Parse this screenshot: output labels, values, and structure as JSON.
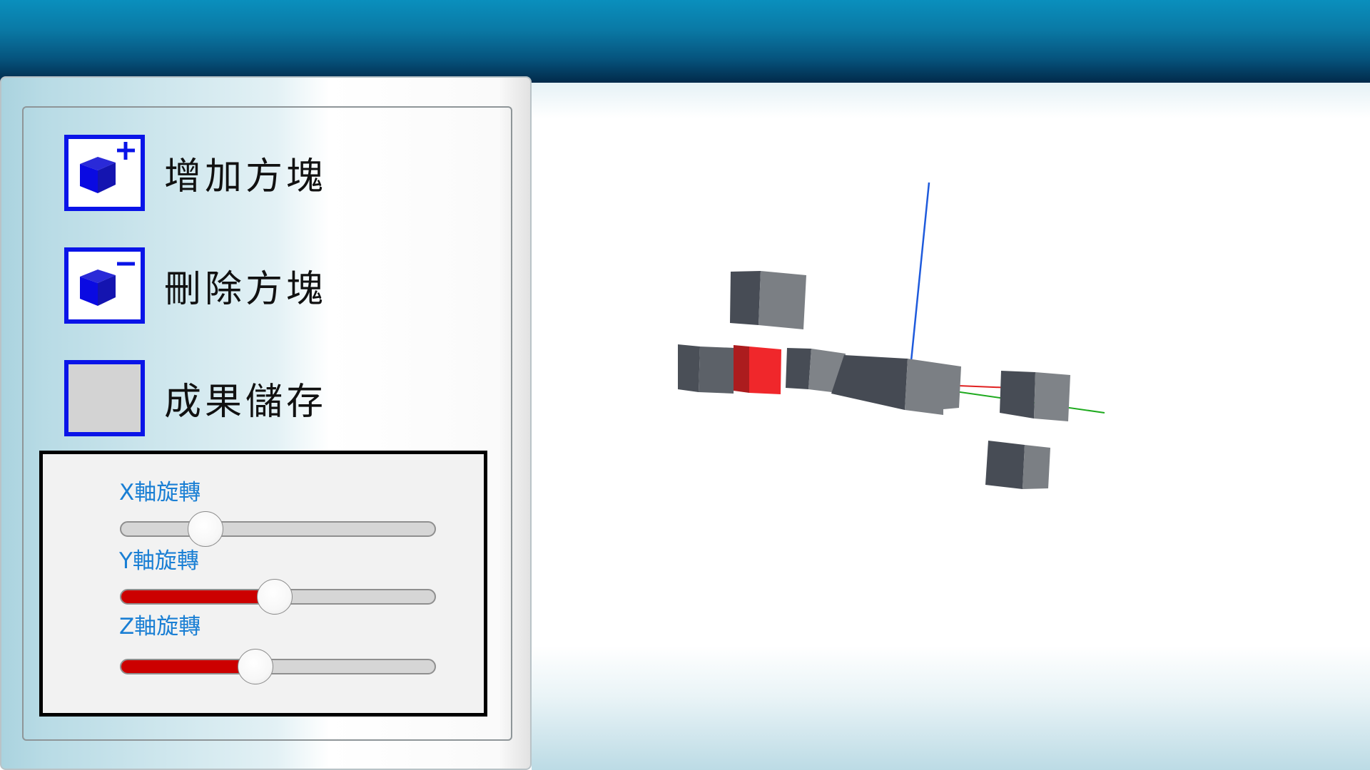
{
  "toolbar": {
    "add_block_label": "增加方塊",
    "add_block_icon": "cube-plus-icon",
    "delete_block_label": "刪除方塊",
    "delete_block_icon": "cube-minus-icon",
    "save_result_label": "成果儲存"
  },
  "rotation": {
    "x": {
      "label": "X軸旋轉",
      "value": 0.27
    },
    "y": {
      "label": "Y軸旋轉",
      "value": 0.49
    },
    "z": {
      "label": "Z軸旋轉",
      "value": 0.43
    }
  },
  "colors": {
    "icon_border": "#0a14e8",
    "slider_fill": "#cc0000",
    "slider_label": "#1a7fd4",
    "selected_block": "#e8262a",
    "block": "#4d525a",
    "axis_x": "#e02020",
    "axis_y": "#1eaa1e",
    "axis_z": "#1e5adc"
  }
}
